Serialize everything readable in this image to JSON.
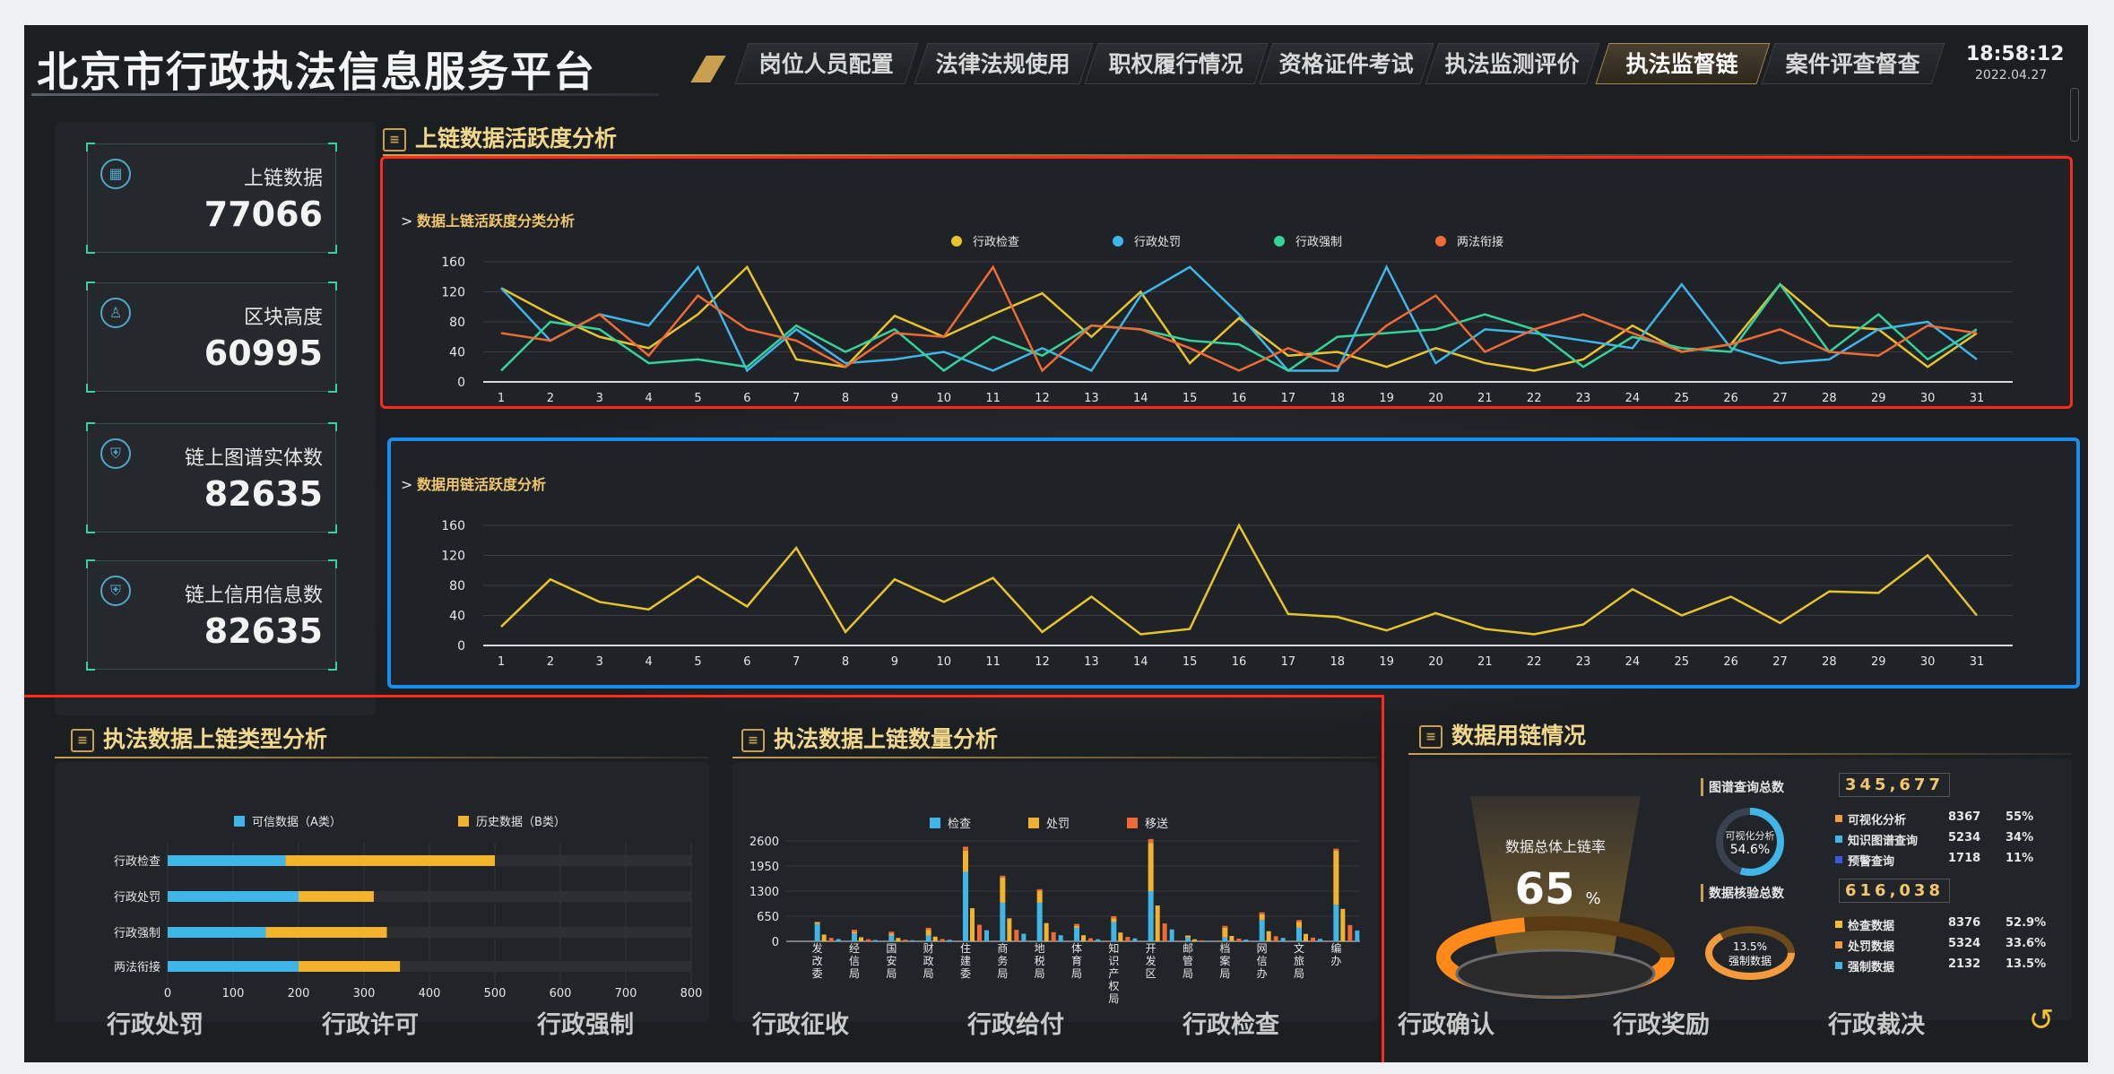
{
  "app": {
    "title": "北京市行政执法信息服务平台",
    "time": "18:58:12",
    "date": "2022.04.27"
  },
  "nav": [
    {
      "label": "岗位人员配置"
    },
    {
      "label": "法律法规使用"
    },
    {
      "label": "职权履行情况"
    },
    {
      "label": "资格证件考试"
    },
    {
      "label": "执法监测评价"
    },
    {
      "label": "执法监督链"
    },
    {
      "label": "案件评查督查"
    }
  ],
  "nav_active_index": 5,
  "stats": [
    {
      "label": "上链数据",
      "value": "77066",
      "icon": "grid-icon"
    },
    {
      "label": "区块高度",
      "value": "60995",
      "icon": "person-icon"
    },
    {
      "label": "链上图谱实体数",
      "value": "82635",
      "icon": "shield-icon"
    },
    {
      "label": "链上信用信息数",
      "value": "82635",
      "icon": "shield-icon"
    }
  ],
  "section_activity": {
    "title": "上链数据活跃度分析"
  },
  "section_type": {
    "title": "执法数据上链类型分析"
  },
  "section_count": {
    "title": "执法数据上链数量分析"
  },
  "section_usage": {
    "title": "数据用链情况"
  },
  "usage": {
    "gauge_label": "数据总体上链率",
    "gauge_value": "65",
    "gauge_unit": "%",
    "gauge_fraction": 0.65,
    "query_title": "图谱查询总数",
    "query_total": "345,677",
    "query_ring_label": "可视化分析",
    "query_ring_value": "54.6%",
    "query_items": [
      {
        "name": "可视化分析",
        "count": "8367",
        "pct": "55%",
        "color": "#f29a3c"
      },
      {
        "name": "知识图谱查询",
        "count": "5234",
        "pct": "34%",
        "color": "#3fb5e8"
      },
      {
        "name": "预警查询",
        "count": "1718",
        "pct": "11%",
        "color": "#3a58e6"
      }
    ],
    "verify_title": "数据核验总数",
    "verify_total": "616,038",
    "verify_ring_label": "13.5%",
    "verify_ring_sub": "强制数据",
    "verify_items": [
      {
        "name": "检查数据",
        "count": "8376",
        "pct": "52.9%",
        "color": "#f2c12e"
      },
      {
        "name": "处罚数据",
        "count": "5324",
        "pct": "33.6%",
        "color": "#f29a3c"
      },
      {
        "name": "强制数据",
        "count": "2132",
        "pct": "13.5%",
        "color": "#3fb5e8"
      }
    ]
  },
  "bottom_nav": [
    {
      "label": "行政处罚"
    },
    {
      "label": "行政许可"
    },
    {
      "label": "行政强制"
    },
    {
      "label": "行政征收"
    },
    {
      "label": "行政给付"
    },
    {
      "label": "行政检查"
    },
    {
      "label": "行政确认"
    },
    {
      "label": "行政奖励"
    },
    {
      "label": "行政裁决"
    }
  ],
  "chart_data": [
    {
      "type": "line",
      "title": "数据上链活跃度分类分析",
      "x": [
        1,
        2,
        3,
        4,
        5,
        6,
        7,
        8,
        9,
        10,
        11,
        12,
        13,
        14,
        15,
        16,
        17,
        18,
        19,
        20,
        21,
        22,
        23,
        24,
        25,
        26,
        27,
        28,
        29,
        30,
        31
      ],
      "ylim": [
        0,
        160
      ],
      "yticks": [
        0,
        40,
        80,
        120,
        160
      ],
      "legend_position": "top",
      "series": [
        {
          "name": "行政检查",
          "color": "#e8c42a",
          "values": [
            125,
            90,
            60,
            45,
            90,
            153,
            30,
            20,
            88,
            60,
            90,
            118,
            60,
            120,
            25,
            85,
            35,
            40,
            20,
            45,
            25,
            15,
            30,
            75,
            40,
            50,
            130,
            75,
            70,
            20,
            65
          ]
        },
        {
          "name": "行政处罚",
          "color": "#3fb5e8",
          "values": [
            125,
            55,
            90,
            75,
            153,
            15,
            70,
            25,
            30,
            40,
            15,
            45,
            15,
            115,
            153,
            90,
            15,
            15,
            153,
            25,
            70,
            65,
            55,
            45,
            130,
            45,
            25,
            30,
            70,
            80,
            30
          ]
        },
        {
          "name": "行政强制",
          "color": "#35d39a",
          "values": [
            15,
            80,
            70,
            25,
            30,
            20,
            75,
            40,
            70,
            15,
            60,
            35,
            75,
            70,
            55,
            50,
            15,
            60,
            65,
            70,
            90,
            70,
            20,
            60,
            45,
            40,
            130,
            40,
            90,
            30,
            70
          ]
        },
        {
          "name": "两法衔接",
          "color": "#ef6a35",
          "values": [
            65,
            55,
            90,
            35,
            115,
            70,
            55,
            20,
            65,
            60,
            153,
            15,
            75,
            70,
            45,
            15,
            45,
            20,
            75,
            115,
            40,
            70,
            90,
            65,
            40,
            50,
            70,
            40,
            35,
            75,
            65
          ]
        }
      ]
    },
    {
      "type": "line",
      "title": "数据用链活跃度分析",
      "x": [
        1,
        2,
        3,
        4,
        5,
        6,
        7,
        8,
        9,
        10,
        11,
        12,
        13,
        14,
        15,
        16,
        17,
        18,
        19,
        20,
        21,
        22,
        23,
        24,
        25,
        26,
        27,
        28,
        29,
        30,
        31
      ],
      "ylim": [
        0,
        160
      ],
      "yticks": [
        0,
        40,
        80,
        120,
        160
      ],
      "series": [
        {
          "color": "#e8c42a",
          "values": [
            25,
            88,
            58,
            48,
            92,
            52,
            130,
            18,
            88,
            58,
            90,
            18,
            65,
            15,
            22,
            160,
            42,
            38,
            20,
            43,
            22,
            15,
            28,
            75,
            40,
            65,
            30,
            72,
            70,
            120,
            40
          ]
        }
      ]
    },
    {
      "type": "bar",
      "orientation": "horizontal",
      "stacked": true,
      "categories": [
        "行政检查",
        "行政处罚",
        "行政强制",
        "两法衔接"
      ],
      "xlim": [
        0,
        800
      ],
      "xticks": [
        0,
        100,
        200,
        300,
        400,
        500,
        600,
        700,
        800
      ],
      "series": [
        {
          "name": "可信数据（A类）",
          "color": "#3fb5e8",
          "values": [
            180,
            200,
            150,
            200
          ]
        },
        {
          "name": "历史数据（B类）",
          "color": "#f2b22e",
          "values": [
            320,
            115,
            185,
            155
          ]
        }
      ]
    },
    {
      "type": "bar",
      "stacked": true,
      "categories": [
        "发改委",
        "经信局",
        "国安局",
        "财政局",
        "住建委",
        "商务局",
        "地税局",
        "体育局",
        "知识产权局",
        "开发区",
        "邮管局",
        "档案局",
        "网信办",
        "文旅局",
        "编办"
      ],
      "ylim": [
        0,
        2600
      ],
      "yticks": [
        0,
        650,
        1300,
        1950,
        2600
      ],
      "series": [
        {
          "name": "检查",
          "color": "#3fb5e8",
          "values": [
            450,
            200,
            150,
            150,
            1800,
            1000,
            1000,
            350,
            500,
            1300,
            100,
            100,
            550,
            350,
            950
          ]
        },
        {
          "name": "处罚",
          "color": "#f2b22e",
          "values": [
            50,
            50,
            50,
            150,
            550,
            650,
            300,
            50,
            100,
            1250,
            50,
            250,
            150,
            150,
            1400
          ]
        },
        {
          "name": "移送",
          "color": "#ef6a35",
          "values": [
            0,
            50,
            50,
            50,
            100,
            50,
            50,
            50,
            50,
            100,
            0,
            50,
            50,
            50,
            50
          ]
        }
      ],
      "columns_per_category": 4
    }
  ]
}
